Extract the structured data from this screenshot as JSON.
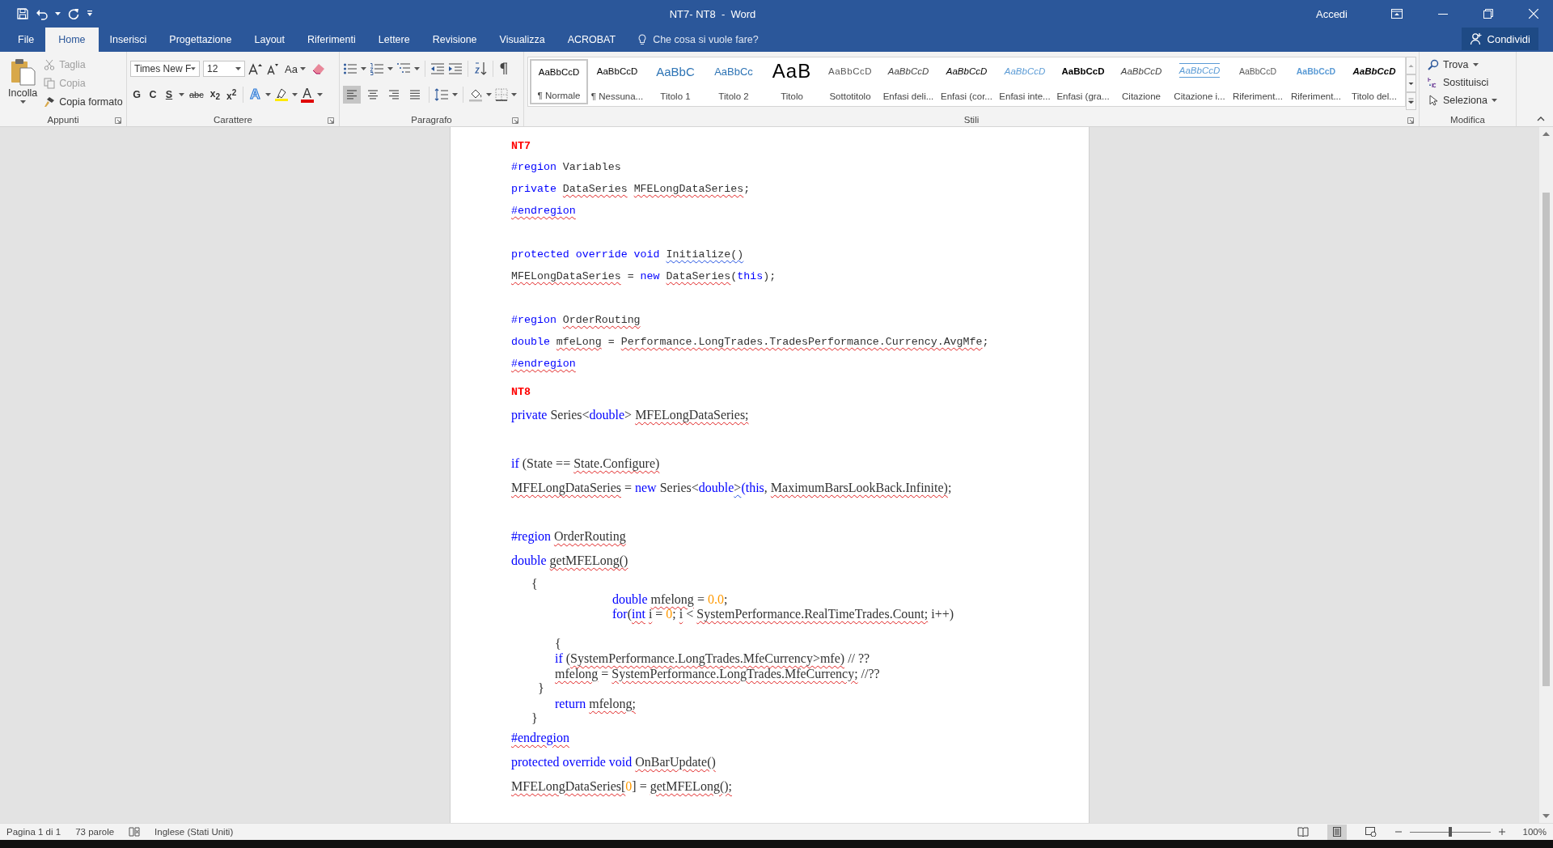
{
  "window": {
    "title": "NT7- NT8  -  Word",
    "account": "Accedi"
  },
  "tabs": [
    {
      "label": "File",
      "selected": false
    },
    {
      "label": "Home",
      "selected": true
    },
    {
      "label": "Inserisci",
      "selected": false
    },
    {
      "label": "Progettazione",
      "selected": false
    },
    {
      "label": "Layout",
      "selected": false
    },
    {
      "label": "Riferimenti",
      "selected": false
    },
    {
      "label": "Lettere",
      "selected": false
    },
    {
      "label": "Revisione",
      "selected": false
    },
    {
      "label": "Visualizza",
      "selected": false
    },
    {
      "label": "ACROBAT",
      "selected": false
    }
  ],
  "tell_me": {
    "placeholder": "Che cosa si vuole fare?"
  },
  "share_button": "Condividi",
  "ribbon": {
    "clipboard": {
      "label": "Appunti",
      "paste": "Incolla",
      "items": [
        {
          "kind": "cut",
          "label": "Taglia",
          "disabled": true
        },
        {
          "kind": "copy",
          "label": "Copia",
          "disabled": true
        },
        {
          "kind": "painter",
          "label": "Copia formato",
          "disabled": false
        }
      ]
    },
    "font": {
      "label": "Carattere",
      "font_name": "Times New F",
      "font_size": "12",
      "change_case": "Aa",
      "buttons": [
        {
          "kind": "bold",
          "label": "G"
        },
        {
          "kind": "italic",
          "label": "C"
        },
        {
          "kind": "underline",
          "label": "S"
        },
        {
          "kind": "strike",
          "label": "abc"
        },
        {
          "kind": "sub",
          "label": "x$_{2}$"
        },
        {
          "kind": "sup",
          "label": "x$^{2}$"
        }
      ],
      "text_effects": "A",
      "font_color": "A"
    },
    "paragraph": {
      "label": "Paragrafo",
      "alignments": [
        {
          "kind": "left",
          "selected": true
        },
        {
          "kind": "center",
          "selected": false
        },
        {
          "kind": "right",
          "selected": false
        },
        {
          "kind": "justify",
          "selected": false
        }
      ]
    },
    "styles": {
      "label": "Stili",
      "items": [
        {
          "kind": "normal",
          "preview": "AaBbCcD",
          "name": "¶ Normale",
          "selected": true
        },
        {
          "kind": "normal",
          "preview": "AaBbCcD",
          "name": "¶ Nessuna...",
          "selected": false
        },
        {
          "kind": "heading1",
          "preview": "AaBbC",
          "name": "Titolo 1",
          "selected": false
        },
        {
          "kind": "heading2",
          "preview": "AaBbCc",
          "name": "Titolo 2",
          "selected": false
        },
        {
          "kind": "title",
          "preview": "AaB",
          "name": "Titolo",
          "selected": false
        },
        {
          "kind": "subtitle",
          "preview": "AaBbCcD",
          "name": "Sottotitolo",
          "selected": false
        },
        {
          "kind": "subtle",
          "preview": "AaBbCcD",
          "name": "Enfasi deli...",
          "selected": false
        },
        {
          "kind": "emphasis",
          "preview": "AaBbCcD",
          "name": "Enfasi (cor...",
          "selected": false
        },
        {
          "kind": "intense",
          "preview": "AaBbCcD",
          "name": "Enfasi inte...",
          "selected": false
        },
        {
          "kind": "strong",
          "preview": "AaBbCcD",
          "name": "Enfasi (gra...",
          "selected": false
        },
        {
          "kind": "quote",
          "preview": "AaBbCcD",
          "name": "Citazione",
          "selected": false
        },
        {
          "kind": "intense_quote",
          "preview": "AaBbCcD",
          "name": "Citazione i...",
          "selected": false
        },
        {
          "kind": "subtle_ref",
          "preview": "AaBbCcD",
          "name": "Riferiment...",
          "selected": false
        },
        {
          "kind": "intense_ref",
          "preview": "AaBbCcD",
          "name": "Riferiment...",
          "selected": false
        },
        {
          "kind": "book_title",
          "preview": "AaBbCcD",
          "name": "Titolo del...",
          "selected": false
        }
      ]
    },
    "editing": {
      "label": "Modifica",
      "find": "Trova",
      "replace": "Sostituisci",
      "select": "Seleziona"
    }
  },
  "document": {
    "lines": [
      {
        "kind": "heading",
        "segments": [
          {
            "t": "NT7",
            "kind": "plain"
          }
        ]
      },
      {
        "kind": "mono",
        "segments": [
          {
            "t": "#region",
            "kind": "keyword"
          },
          {
            "t": " Variables",
            "kind": "plain"
          }
        ]
      },
      {
        "kind": "mono",
        "segments": [
          {
            "t": "private ",
            "kind": "keyword"
          },
          {
            "t": "DataSeries",
            "kind": "plain",
            "misspelled": true
          },
          {
            "t": " MFELongDataSeries",
            "kind": "plain",
            "misspelled": true
          },
          {
            "t": ";",
            "kind": "plain"
          }
        ]
      },
      {
        "kind": "mono",
        "segments": [
          {
            "t": "#endregion",
            "kind": "keyword",
            "misspelled": true
          }
        ]
      },
      {
        "kind": "mono",
        "space_before": true,
        "segments": [
          {
            "t": "protected override void ",
            "kind": "keyword"
          },
          {
            "t": "Initialize()",
            "kind": "plain",
            "grammar": true
          }
        ]
      },
      {
        "kind": "mono",
        "segments": [
          {
            "t": "MFELongDataSeries",
            "kind": "plain",
            "misspelled": true
          },
          {
            "t": " = ",
            "kind": "plain"
          },
          {
            "t": "new ",
            "kind": "keyword"
          },
          {
            "t": "DataSeries",
            "kind": "plain",
            "misspelled": true
          },
          {
            "t": "(",
            "kind": "plain"
          },
          {
            "t": "this",
            "kind": "keyword"
          },
          {
            "t": ");",
            "kind": "plain"
          }
        ]
      },
      {
        "kind": "mono",
        "space_before": true,
        "segments": [
          {
            "t": "#region ",
            "kind": "keyword"
          },
          {
            "t": "OrderRouting",
            "kind": "plain",
            "misspelled": true
          }
        ]
      },
      {
        "kind": "mono",
        "segments": [
          {
            "t": "double ",
            "kind": "keyword"
          },
          {
            "t": "mfeLong",
            "kind": "plain",
            "misspelled": true
          },
          {
            "t": " = ",
            "kind": "plain"
          },
          {
            "t": "Performance.LongTrades.TradesPerformance.Currency.AvgMfe",
            "kind": "plain",
            "misspelled": true
          },
          {
            "t": ";",
            "kind": "plain"
          }
        ]
      },
      {
        "kind": "mono",
        "segments": [
          {
            "t": "#endregion",
            "kind": "keyword",
            "misspelled": true
          }
        ]
      },
      {
        "kind": "heading",
        "segments": [
          {
            "t": "NT8",
            "kind": "plain"
          }
        ]
      },
      {
        "kind": "serif",
        "segments": [
          {
            "t": "private",
            "kind": "keyword"
          },
          {
            "t": " Series<",
            "kind": "plain"
          },
          {
            "t": "double",
            "kind": "keyword"
          },
          {
            "t": "> ",
            "kind": "plain"
          },
          {
            "t": "MFELongDataSeries;",
            "kind": "plain",
            "misspelled": true
          }
        ]
      },
      {
        "kind": "serif",
        "space_before": true,
        "segments": [
          {
            "t": "if",
            "kind": "keyword"
          },
          {
            "t": " (State == ",
            "kind": "plain"
          },
          {
            "t": "State.Configure)",
            "kind": "plain",
            "misspelled": true
          }
        ]
      },
      {
        "kind": "serif",
        "segments": [
          {
            "t": "MFELongDataSeries",
            "kind": "plain",
            "misspelled": true
          },
          {
            "t": " = ",
            "kind": "plain"
          },
          {
            "t": "new",
            "kind": "keyword"
          },
          {
            "t": " Series<",
            "kind": "plain"
          },
          {
            "t": "double",
            "kind": "keyword"
          },
          {
            "t": ">",
            "kind": "plain",
            "grammar": true
          },
          {
            "t": "(this",
            "kind": "keyword"
          },
          {
            "t": ", ",
            "kind": "plain"
          },
          {
            "t": "MaximumBarsLookBack.Infinite)",
            "kind": "plain",
            "misspelled": true
          },
          {
            "t": ";",
            "kind": "plain"
          }
        ]
      },
      {
        "kind": "serif",
        "space_before": true,
        "segments": [
          {
            "t": "#region ",
            "kind": "keyword"
          },
          {
            "t": "OrderRouting",
            "kind": "plain",
            "misspelled": true
          }
        ]
      },
      {
        "kind": "serif",
        "segments": [
          {
            "t": "double ",
            "kind": "keyword"
          },
          {
            "t": "getMFELong()",
            "kind": "plain",
            "misspelled": true
          }
        ]
      },
      {
        "kind": "tight",
        "segments": [
          {
            "t": "\t{",
            "kind": "plain"
          }
        ]
      },
      {
        "kind": "tight",
        "segments": [
          {
            "t": "\t\t\t\t\tdouble ",
            "kind": "keyword"
          },
          {
            "t": "mfelong",
            "kind": "plain",
            "misspelled": true
          },
          {
            "t": " = ",
            "kind": "plain"
          },
          {
            "t": "0.0",
            "kind": "number"
          },
          {
            "t": ";",
            "kind": "plain"
          }
        ]
      },
      {
        "kind": "tight",
        "segments": [
          {
            "t": "\t\t\t\t\tfor",
            "kind": "keyword"
          },
          {
            "t": "(",
            "kind": "plain"
          },
          {
            "t": "int",
            "kind": "keyword",
            "misspelled": true
          },
          {
            "t": " i",
            "kind": "plain",
            "misspelled": true
          },
          {
            "t": " = ",
            "kind": "plain"
          },
          {
            "t": "0",
            "kind": "number"
          },
          {
            "t": "; ",
            "kind": "plain"
          },
          {
            "t": "i",
            "kind": "plain",
            "misspelled": true
          },
          {
            "t": " < ",
            "kind": "plain"
          },
          {
            "t": "SystemPerformance.RealTimeTrades.Count;",
            "kind": "plain",
            "misspelled": true
          },
          {
            "t": " i++)",
            "kind": "plain"
          }
        ]
      },
      {
        "kind": "tight",
        "space_before": true,
        "segments": [
          {
            "t": "\t\t {",
            "kind": "plain"
          }
        ]
      },
      {
        "kind": "tight",
        "segments": [
          {
            "t": "\t\t if",
            "kind": "keyword"
          },
          {
            "t": " (",
            "kind": "plain"
          },
          {
            "t": "SystemPerformance.LongTrades.MfeCurrency>mfe)",
            "kind": "plain",
            "misspelled": true
          },
          {
            "t": " // ??",
            "kind": "plain"
          }
        ]
      },
      {
        "kind": "tight",
        "segments": [
          {
            "t": "\t\t mfelong",
            "kind": "plain",
            "misspelled": true
          },
          {
            "t": " = ",
            "kind": "plain"
          },
          {
            "t": "SystemPerformance.LongTrades.MfeCurrency;",
            "kind": "plain",
            "misspelled": true
          },
          {
            "t": " //??",
            "kind": "plain"
          }
        ]
      },
      {
        "kind": "tight",
        "segments": [
          {
            "t": "\t  }",
            "kind": "plain"
          }
        ]
      },
      {
        "kind": "tight",
        "segments": [
          {
            "t": "\t\t return ",
            "kind": "keyword"
          },
          {
            "t": "mfelong;",
            "kind": "plain",
            "misspelled": true
          }
        ]
      },
      {
        "kind": "tight",
        "segments": [
          {
            "t": "\t}",
            "kind": "plain"
          }
        ]
      },
      {
        "kind": "serif",
        "segments": [
          {
            "t": "#endregion",
            "kind": "keyword",
            "misspelled": true
          }
        ]
      },
      {
        "kind": "serif",
        "segments": [
          {
            "t": "protected override void ",
            "kind": "keyword"
          },
          {
            "t": "OnBarUpdate()",
            "kind": "plain",
            "misspelled": true
          }
        ]
      },
      {
        "kind": "serif",
        "segments": [
          {
            "t": "MFELongDataSeries[",
            "kind": "plain",
            "misspelled": true
          },
          {
            "t": "0",
            "kind": "number"
          },
          {
            "t": "] = ",
            "kind": "plain"
          },
          {
            "t": "getMFELong();",
            "kind": "plain",
            "misspelled": true
          }
        ]
      }
    ]
  },
  "status_bar": {
    "page": "Pagina 1 di 1",
    "words": "73 parole",
    "language": "Inglese (Stati Uniti)",
    "views": [
      {
        "kind": "read",
        "selected": false
      },
      {
        "kind": "print",
        "selected": true
      },
      {
        "kind": "web",
        "selected": false
      }
    ],
    "zoom": {
      "level": 0.5,
      "reading": "100%"
    }
  }
}
